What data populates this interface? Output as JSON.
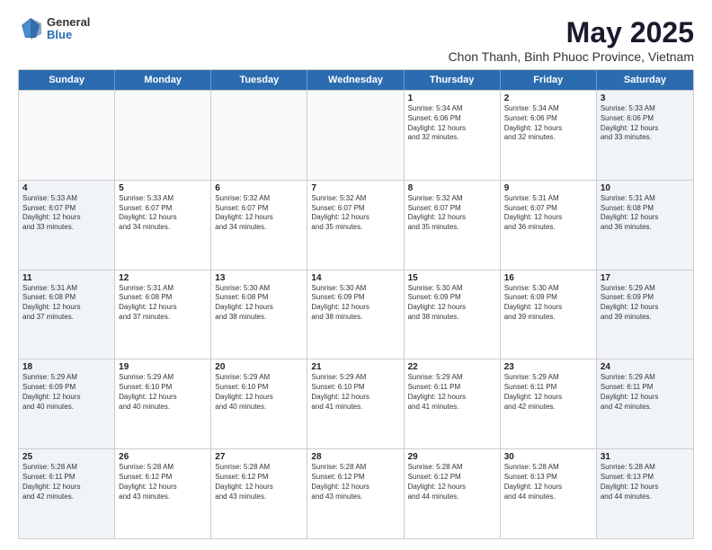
{
  "logo": {
    "general": "General",
    "blue": "Blue"
  },
  "header": {
    "month": "May 2025",
    "location": "Chon Thanh, Binh Phuoc Province, Vietnam"
  },
  "days": [
    "Sunday",
    "Monday",
    "Tuesday",
    "Wednesday",
    "Thursday",
    "Friday",
    "Saturday"
  ],
  "rows": [
    [
      {
        "day": "",
        "empty": true
      },
      {
        "day": "",
        "empty": true
      },
      {
        "day": "",
        "empty": true
      },
      {
        "day": "",
        "empty": true
      },
      {
        "day": "1",
        "lines": [
          "Sunrise: 5:34 AM",
          "Sunset: 6:06 PM",
          "Daylight: 12 hours",
          "and 32 minutes."
        ]
      },
      {
        "day": "2",
        "lines": [
          "Sunrise: 5:34 AM",
          "Sunset: 6:06 PM",
          "Daylight: 12 hours",
          "and 32 minutes."
        ]
      },
      {
        "day": "3",
        "shaded": true,
        "lines": [
          "Sunrise: 5:33 AM",
          "Sunset: 6:06 PM",
          "Daylight: 12 hours",
          "and 33 minutes."
        ]
      }
    ],
    [
      {
        "day": "4",
        "shaded": true,
        "lines": [
          "Sunrise: 5:33 AM",
          "Sunset: 6:07 PM",
          "Daylight: 12 hours",
          "and 33 minutes."
        ]
      },
      {
        "day": "5",
        "lines": [
          "Sunrise: 5:33 AM",
          "Sunset: 6:07 PM",
          "Daylight: 12 hours",
          "and 34 minutes."
        ]
      },
      {
        "day": "6",
        "lines": [
          "Sunrise: 5:32 AM",
          "Sunset: 6:07 PM",
          "Daylight: 12 hours",
          "and 34 minutes."
        ]
      },
      {
        "day": "7",
        "lines": [
          "Sunrise: 5:32 AM",
          "Sunset: 6:07 PM",
          "Daylight: 12 hours",
          "and 35 minutes."
        ]
      },
      {
        "day": "8",
        "lines": [
          "Sunrise: 5:32 AM",
          "Sunset: 6:07 PM",
          "Daylight: 12 hours",
          "and 35 minutes."
        ]
      },
      {
        "day": "9",
        "lines": [
          "Sunrise: 5:31 AM",
          "Sunset: 6:07 PM",
          "Daylight: 12 hours",
          "and 36 minutes."
        ]
      },
      {
        "day": "10",
        "shaded": true,
        "lines": [
          "Sunrise: 5:31 AM",
          "Sunset: 6:08 PM",
          "Daylight: 12 hours",
          "and 36 minutes."
        ]
      }
    ],
    [
      {
        "day": "11",
        "shaded": true,
        "lines": [
          "Sunrise: 5:31 AM",
          "Sunset: 6:08 PM",
          "Daylight: 12 hours",
          "and 37 minutes."
        ]
      },
      {
        "day": "12",
        "lines": [
          "Sunrise: 5:31 AM",
          "Sunset: 6:08 PM",
          "Daylight: 12 hours",
          "and 37 minutes."
        ]
      },
      {
        "day": "13",
        "lines": [
          "Sunrise: 5:30 AM",
          "Sunset: 6:08 PM",
          "Daylight: 12 hours",
          "and 38 minutes."
        ]
      },
      {
        "day": "14",
        "lines": [
          "Sunrise: 5:30 AM",
          "Sunset: 6:09 PM",
          "Daylight: 12 hours",
          "and 38 minutes."
        ]
      },
      {
        "day": "15",
        "lines": [
          "Sunrise: 5:30 AM",
          "Sunset: 6:09 PM",
          "Daylight: 12 hours",
          "and 38 minutes."
        ]
      },
      {
        "day": "16",
        "lines": [
          "Sunrise: 5:30 AM",
          "Sunset: 6:09 PM",
          "Daylight: 12 hours",
          "and 39 minutes."
        ]
      },
      {
        "day": "17",
        "shaded": true,
        "lines": [
          "Sunrise: 5:29 AM",
          "Sunset: 6:09 PM",
          "Daylight: 12 hours",
          "and 39 minutes."
        ]
      }
    ],
    [
      {
        "day": "18",
        "shaded": true,
        "lines": [
          "Sunrise: 5:29 AM",
          "Sunset: 6:09 PM",
          "Daylight: 12 hours",
          "and 40 minutes."
        ]
      },
      {
        "day": "19",
        "lines": [
          "Sunrise: 5:29 AM",
          "Sunset: 6:10 PM",
          "Daylight: 12 hours",
          "and 40 minutes."
        ]
      },
      {
        "day": "20",
        "lines": [
          "Sunrise: 5:29 AM",
          "Sunset: 6:10 PM",
          "Daylight: 12 hours",
          "and 40 minutes."
        ]
      },
      {
        "day": "21",
        "lines": [
          "Sunrise: 5:29 AM",
          "Sunset: 6:10 PM",
          "Daylight: 12 hours",
          "and 41 minutes."
        ]
      },
      {
        "day": "22",
        "lines": [
          "Sunrise: 5:29 AM",
          "Sunset: 6:11 PM",
          "Daylight: 12 hours",
          "and 41 minutes."
        ]
      },
      {
        "day": "23",
        "lines": [
          "Sunrise: 5:29 AM",
          "Sunset: 6:11 PM",
          "Daylight: 12 hours",
          "and 42 minutes."
        ]
      },
      {
        "day": "24",
        "shaded": true,
        "lines": [
          "Sunrise: 5:29 AM",
          "Sunset: 6:11 PM",
          "Daylight: 12 hours",
          "and 42 minutes."
        ]
      }
    ],
    [
      {
        "day": "25",
        "shaded": true,
        "lines": [
          "Sunrise: 5:28 AM",
          "Sunset: 6:11 PM",
          "Daylight: 12 hours",
          "and 42 minutes."
        ]
      },
      {
        "day": "26",
        "lines": [
          "Sunrise: 5:28 AM",
          "Sunset: 6:12 PM",
          "Daylight: 12 hours",
          "and 43 minutes."
        ]
      },
      {
        "day": "27",
        "lines": [
          "Sunrise: 5:28 AM",
          "Sunset: 6:12 PM",
          "Daylight: 12 hours",
          "and 43 minutes."
        ]
      },
      {
        "day": "28",
        "lines": [
          "Sunrise: 5:28 AM",
          "Sunset: 6:12 PM",
          "Daylight: 12 hours",
          "and 43 minutes."
        ]
      },
      {
        "day": "29",
        "lines": [
          "Sunrise: 5:28 AM",
          "Sunset: 6:12 PM",
          "Daylight: 12 hours",
          "and 44 minutes."
        ]
      },
      {
        "day": "30",
        "lines": [
          "Sunrise: 5:28 AM",
          "Sunset: 6:13 PM",
          "Daylight: 12 hours",
          "and 44 minutes."
        ]
      },
      {
        "day": "31",
        "shaded": true,
        "lines": [
          "Sunrise: 5:28 AM",
          "Sunset: 6:13 PM",
          "Daylight: 12 hours",
          "and 44 minutes."
        ]
      }
    ]
  ]
}
